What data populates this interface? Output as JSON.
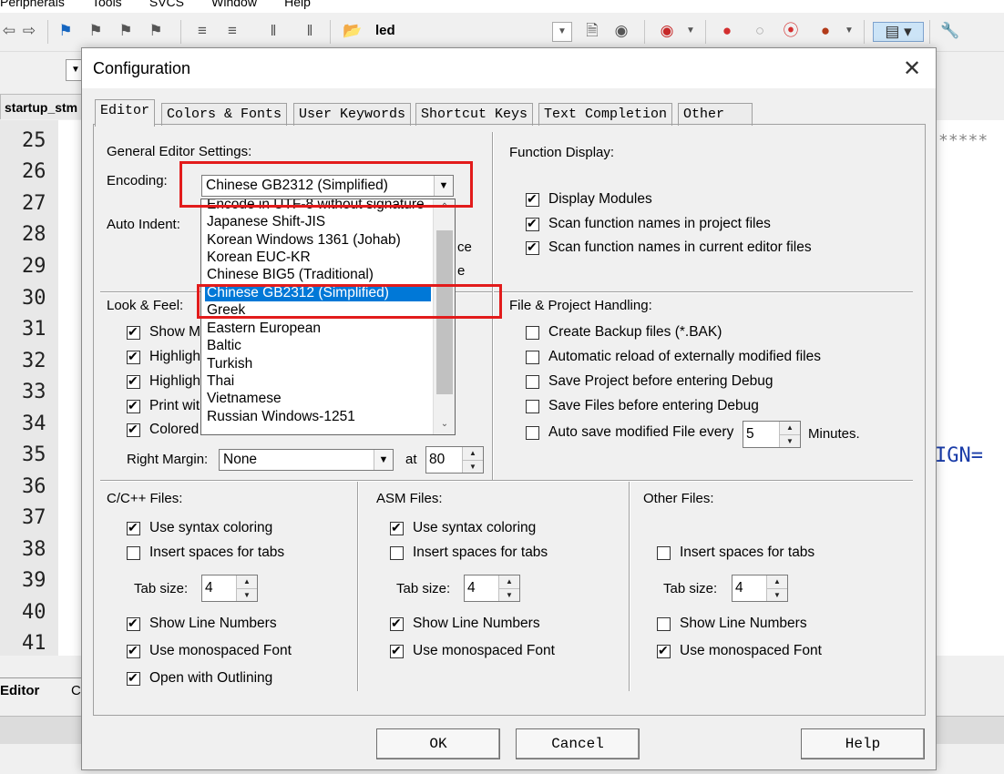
{
  "ide": {
    "menu": [
      "Peripherals",
      "Tools",
      "SVCS",
      "Window",
      "Help"
    ],
    "target_name": "led",
    "file_tab": "startup_stm",
    "line_numbers": [
      "25",
      "26",
      "27",
      "28",
      "29",
      "30",
      "31",
      "32",
      "33",
      "34",
      "35",
      "36",
      "37",
      "38",
      "39",
      "40",
      "41"
    ],
    "code_fragment_stars": "*****",
    "code_fragment_ign": "IGN=",
    "bottom_tabs": [
      "Editor",
      "C"
    ]
  },
  "dialog": {
    "title": "Configuration",
    "tabs": [
      "Editor",
      "Colors & Fonts",
      "User Keywords",
      "Shortcut Keys",
      "Text Completion",
      "Other"
    ],
    "active_tab": "Editor",
    "general": {
      "label": "General Editor Settings:",
      "encoding_label": "Encoding:",
      "encoding_value": "Chinese GB2312 (Simplified)",
      "auto_indent_label": "Auto Indent:",
      "partial_ce": "ce",
      "partial_e": "e"
    },
    "encoding_options": [
      "Encode in UTF-8 without signature",
      "Japanese Shift-JIS",
      "Korean Windows 1361 (Johab)",
      "Korean EUC-KR",
      "Chinese BIG5 (Traditional)",
      "Chinese GB2312 (Simplified)",
      "Greek",
      "Eastern European",
      "Baltic",
      "Turkish",
      "Thai",
      "Vietnamese",
      "Russian Windows-1251"
    ],
    "function_display": {
      "label": "Function Display:",
      "items": [
        {
          "label": "Display Modules",
          "checked": true
        },
        {
          "label": "Scan function names in project files",
          "checked": true
        },
        {
          "label": "Scan function names in current editor files",
          "checked": true
        }
      ]
    },
    "look_feel": {
      "label": "Look & Feel:",
      "items": [
        {
          "label": "Show M",
          "checked": true
        },
        {
          "label": "Highligh",
          "checked": true
        },
        {
          "label": "Highligh",
          "checked": true
        },
        {
          "label": "Print wit",
          "checked": true
        },
        {
          "label": "Colored",
          "checked": true
        }
      ],
      "right_margin_label": "Right Margin:",
      "right_margin_value": "None",
      "at_label": "at",
      "at_value": "80"
    },
    "file_project": {
      "label": "File & Project Handling:",
      "items": [
        {
          "label": "Create Backup files (*.BAK)",
          "checked": false
        },
        {
          "label": "Automatic reload of externally modified files",
          "checked": false
        },
        {
          "label": "Save Project before entering Debug",
          "checked": false
        },
        {
          "label": "Save Files before entering Debug",
          "checked": false
        }
      ],
      "autosave_label": "Auto save modified File every",
      "autosave_checked": false,
      "autosave_value": "5",
      "minutes_label": "Minutes."
    },
    "cpp_files": {
      "label": "C/C++ Files:",
      "syntax": {
        "label": "Use syntax coloring",
        "checked": true
      },
      "spaces": {
        "label": "Insert spaces for tabs",
        "checked": false
      },
      "tab_size_label": "Tab size:",
      "tab_size": "4",
      "line_numbers": {
        "label": "Show Line Numbers",
        "checked": true
      },
      "mono": {
        "label": "Use monospaced Font",
        "checked": true
      },
      "outlining": {
        "label": "Open with Outlining",
        "checked": true
      }
    },
    "asm_files": {
      "label": "ASM Files:",
      "syntax": {
        "label": "Use syntax coloring",
        "checked": true
      },
      "spaces": {
        "label": "Insert spaces for tabs",
        "checked": false
      },
      "tab_size_label": "Tab size:",
      "tab_size": "4",
      "line_numbers": {
        "label": "Show Line Numbers",
        "checked": true
      },
      "mono": {
        "label": "Use monospaced Font",
        "checked": true
      }
    },
    "other_files": {
      "label": "Other Files:",
      "spaces": {
        "label": "Insert spaces for tabs",
        "checked": false
      },
      "tab_size_label": "Tab size:",
      "tab_size": "4",
      "line_numbers": {
        "label": "Show Line Numbers",
        "checked": false
      },
      "mono": {
        "label": "Use monospaced Font",
        "checked": true
      }
    },
    "buttons": {
      "ok": "OK",
      "cancel": "Cancel",
      "help": "Help"
    }
  },
  "colors": {
    "highlight_box": "#e21b1b",
    "selection": "#0078d7"
  }
}
